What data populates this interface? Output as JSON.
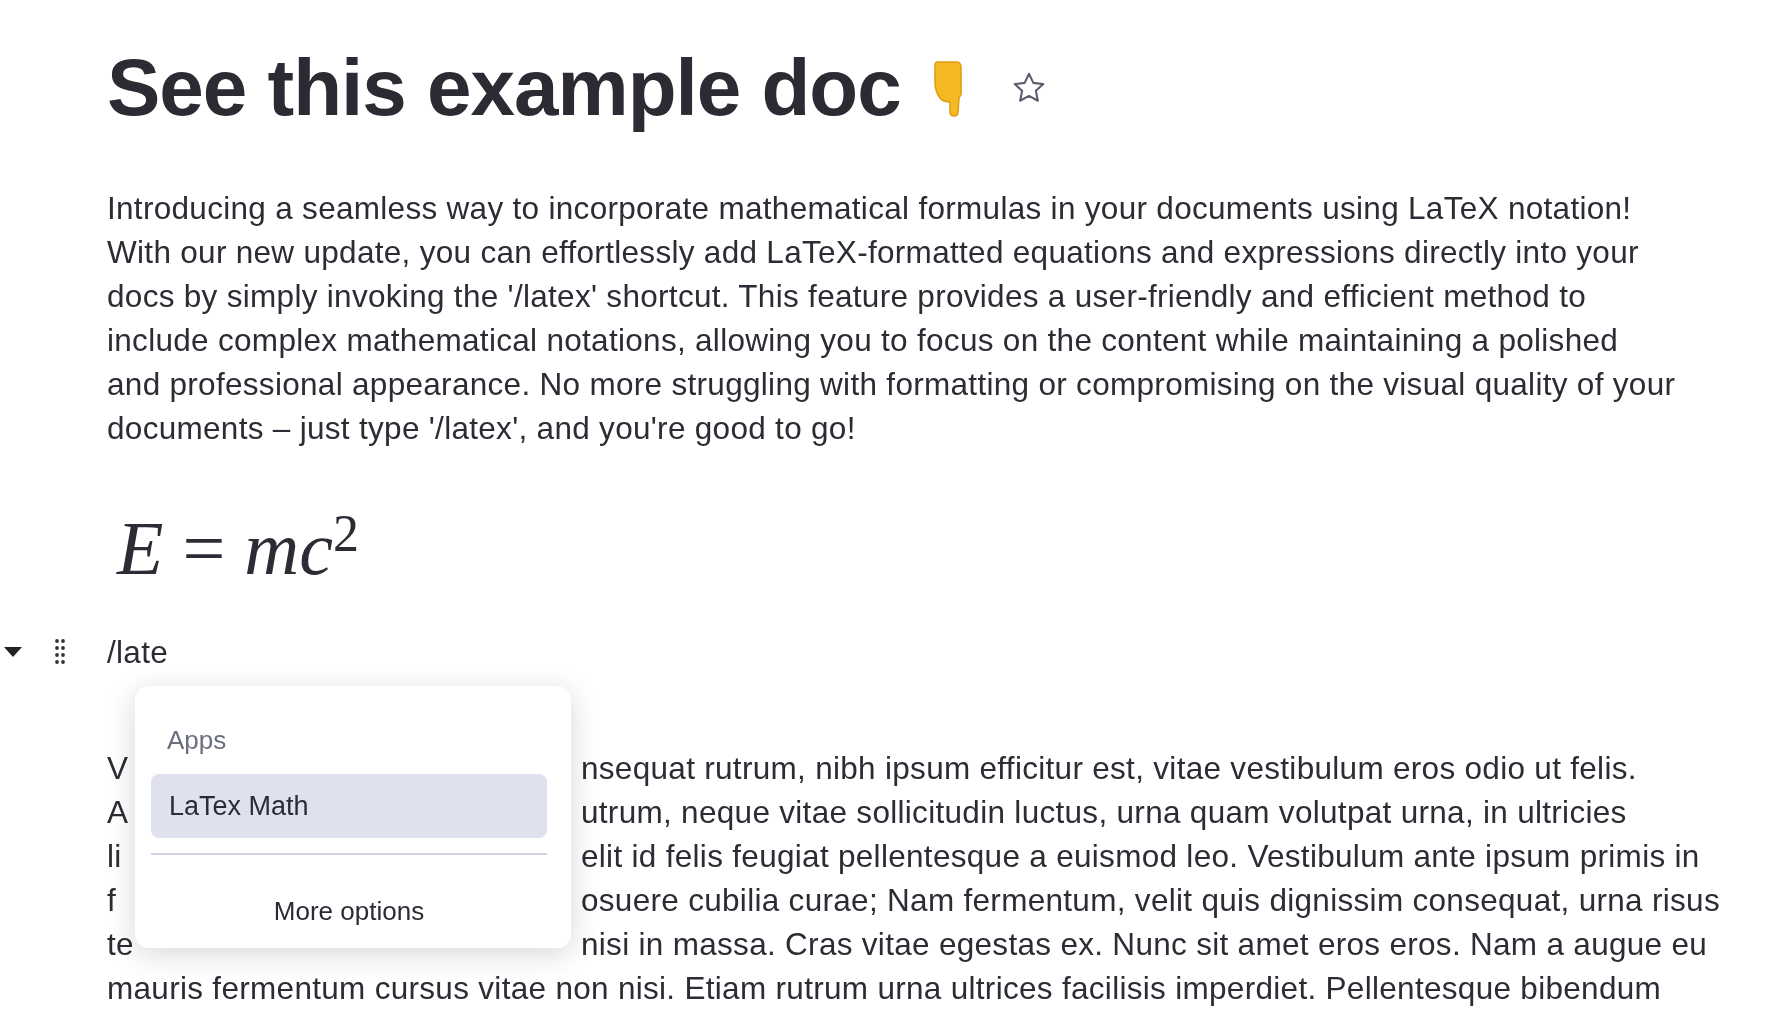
{
  "title": "See this example doc",
  "starred": false,
  "intro": {
    "lines": [
      "Introducing a seamless way to incorporate mathematical formulas in your documents using LaTeX notation!",
      "With our new update, you can effortlessly add LaTeX-formatted equations and expressions directly into your",
      "docs by simply invoking the '/latex' shortcut. This feature provides a user-friendly and efficient method to",
      "include complex mathematical notations, allowing you to focus on the content while maintaining a polished",
      "and professional appearance. No more struggling with formatting or compromising on the visual quality of your",
      "documents – just type '/latex', and you're good to go!"
    ]
  },
  "formula": "*E* = *mc*$^{2}$",
  "block": {
    "expanded": true,
    "text": "/late"
  },
  "paragraph_2": {
    "lines": [
      {
        "left": "V",
        "right": "nsequat rutrum, nibh ipsum efficitur est, vitae vestibulum eros odio ut felis."
      },
      {
        "left": "A",
        "right": "utrum, neque vitae sollicitudin luctus, urna quam volutpat urna, in ultricies"
      },
      {
        "left": "li",
        "right": "elit id felis feugiat pellentesque a euismod leo. Vestibulum ante ipsum primis in"
      },
      {
        "left": "f",
        "right": "osuere cubilia curae; Nam fermentum, velit quis dignissim consequat, urna risus"
      },
      {
        "left": "te",
        "right": "nisi in massa. Cras vitae egestas ex. Nunc sit amet eros eros. Nam a augue eu"
      },
      {
        "text": "mauris fermentum cursus vitae non nisi. Etiam rutrum urna ultrices facilisis imperdiet. Pellentesque bibendum"
      }
    ]
  },
  "menu": {
    "section": "Apps",
    "items": [
      {
        "label": "LaTex Math",
        "selected": true
      }
    ],
    "more": "More options"
  }
}
